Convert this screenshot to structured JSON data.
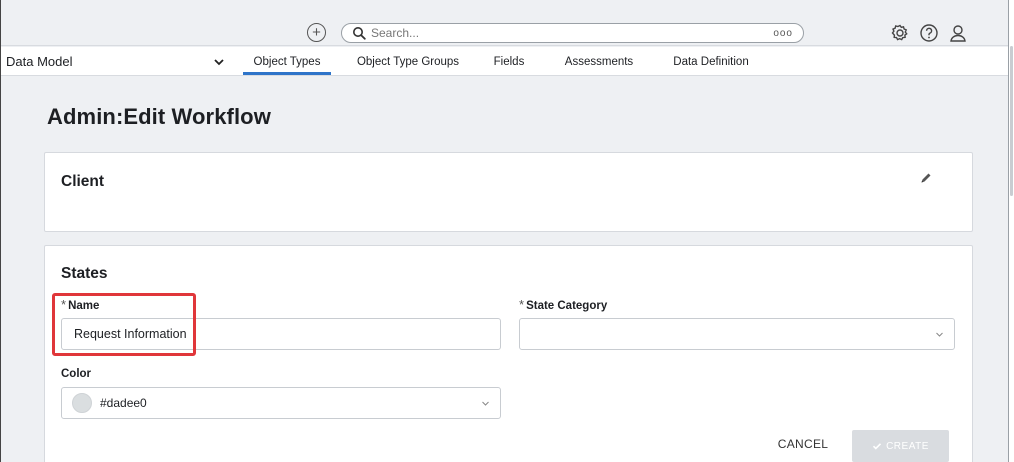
{
  "topbar": {
    "search_placeholder": "Search...",
    "plus_icon": "plus-circle-icon",
    "more_icon": "ellipsis-icon",
    "icons": [
      "gear-icon",
      "help-icon",
      "user-icon"
    ]
  },
  "nav": {
    "module_select": "Data Model",
    "tabs": [
      {
        "label": "Object Types",
        "active": true
      },
      {
        "label": "Object Type Groups",
        "active": false
      },
      {
        "label": "Fields",
        "active": false
      },
      {
        "label": "Assessments",
        "active": false
      },
      {
        "label": "Data Definition",
        "active": false
      }
    ]
  },
  "page": {
    "title": "Admin:Edit Workflow"
  },
  "client_card": {
    "title": "Client",
    "edit_icon": "pencil-icon"
  },
  "states_card": {
    "title": "States",
    "name_label": "Name",
    "name_required_mark": "*",
    "name_value": "Request Information",
    "state_category_label": "State Category",
    "state_category_required_mark": "*",
    "state_category_value": "",
    "color_label": "Color",
    "color_value": "#dadee0",
    "color_swatch": "#dadee0",
    "cancel_label": "CANCEL",
    "create_label": "CREATE"
  },
  "colors": {
    "accent": "#2e74c9",
    "highlight": "#e0363a",
    "create_disabled": "#d9dce0"
  }
}
